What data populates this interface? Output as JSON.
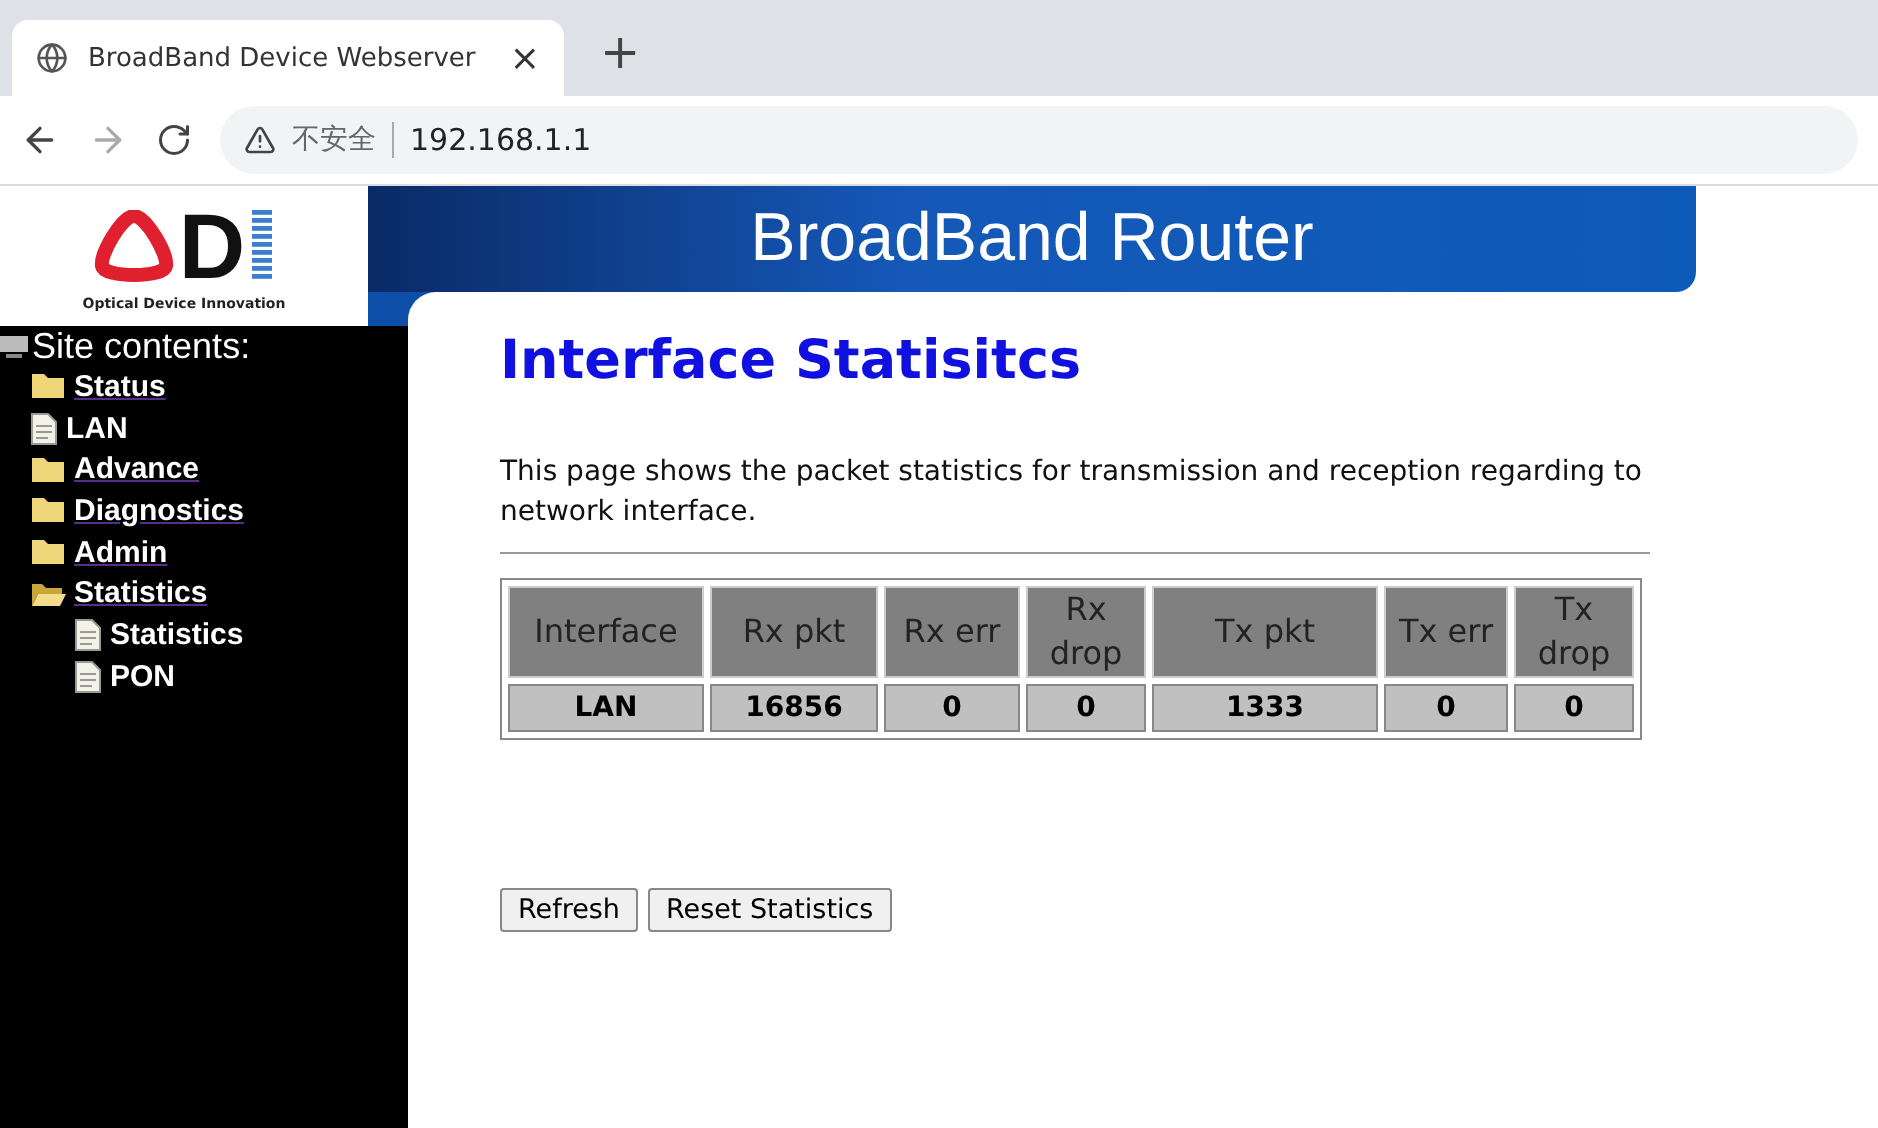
{
  "browser": {
    "tab": {
      "title": "BroadBand Device Webserver",
      "close": "×"
    },
    "new_tab": "+",
    "security_label": "不安全",
    "address": "192.168.1.1"
  },
  "logo": {
    "letter": "D",
    "tagline": "Optical Device Innovation"
  },
  "banner": {
    "title": "BroadBand Router"
  },
  "sidebar": {
    "title": "Site contents:",
    "items": [
      {
        "label": "Status",
        "kind": "folder",
        "expanded": false
      },
      {
        "label": "LAN",
        "kind": "page"
      },
      {
        "label": "Advance",
        "kind": "folder",
        "expanded": false
      },
      {
        "label": "Diagnostics",
        "kind": "folder",
        "expanded": false
      },
      {
        "label": "Admin",
        "kind": "folder",
        "expanded": false
      },
      {
        "label": "Statistics",
        "kind": "folder",
        "expanded": true,
        "children": [
          {
            "label": "Statistics",
            "kind": "page"
          },
          {
            "label": "PON",
            "kind": "page"
          }
        ]
      }
    ]
  },
  "page": {
    "title": "Interface Statisitcs",
    "description": "This page shows the packet statistics for transmission and reception regarding to network interface."
  },
  "table": {
    "columns": [
      "Interface",
      "Rx pkt",
      "Rx err",
      "Rx drop",
      "Tx pkt",
      "Tx err",
      "Tx drop"
    ],
    "rows": [
      [
        "LAN",
        "16856",
        "0",
        "0",
        "1333",
        "0",
        "0"
      ]
    ]
  },
  "buttons": [
    "Refresh",
    "Reset Statistics"
  ]
}
